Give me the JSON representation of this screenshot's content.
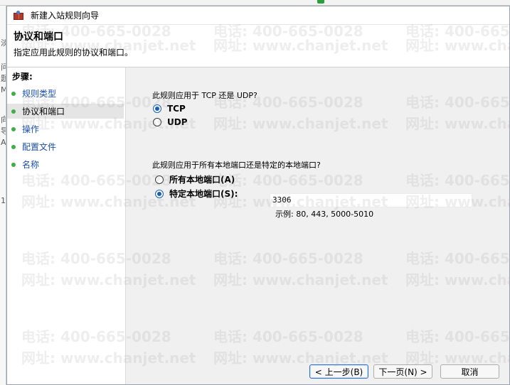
{
  "background": {
    "left_items": [
      "淡",
      "问题",
      "M",
      "向导",
      "A",
      "1"
    ]
  },
  "dialog": {
    "title": "新建入站规则向导",
    "header_title": "协议和端口",
    "header_subtitle": "指定应用此规则的协议和端口。"
  },
  "steps": {
    "title": "步骤:",
    "items": [
      {
        "label": "规则类型",
        "active": false
      },
      {
        "label": "协议和端口",
        "active": true
      },
      {
        "label": "操作",
        "active": false
      },
      {
        "label": "配置文件",
        "active": false
      },
      {
        "label": "名称",
        "active": false
      }
    ]
  },
  "protocol": {
    "question": "此规则应用于 TCP 还是 UDP?",
    "options": [
      {
        "label": "TCP",
        "checked": true
      },
      {
        "label": "UDP",
        "checked": false
      }
    ]
  },
  "ports": {
    "question": "此规则应用于所有本地端口还是特定的本地端口?",
    "options": [
      {
        "label": "所有本地端口(A)",
        "checked": false
      },
      {
        "label": "特定本地端口(S):",
        "checked": true
      }
    ],
    "value": "3306",
    "example": "示例: 80, 443, 5000-5010"
  },
  "buttons": {
    "back": "< 上一步(B)",
    "next": "下一页(N) >",
    "cancel": "取消"
  },
  "watermark": {
    "phone": "电话: 400-665-0028",
    "site": "网址: www.chanjet.net"
  },
  "colors": {
    "link": "#1a4fa8",
    "bullet": "#3fae45",
    "radio_selected": "#1a5fb4",
    "primary_button_border": "#2b6fd4"
  }
}
